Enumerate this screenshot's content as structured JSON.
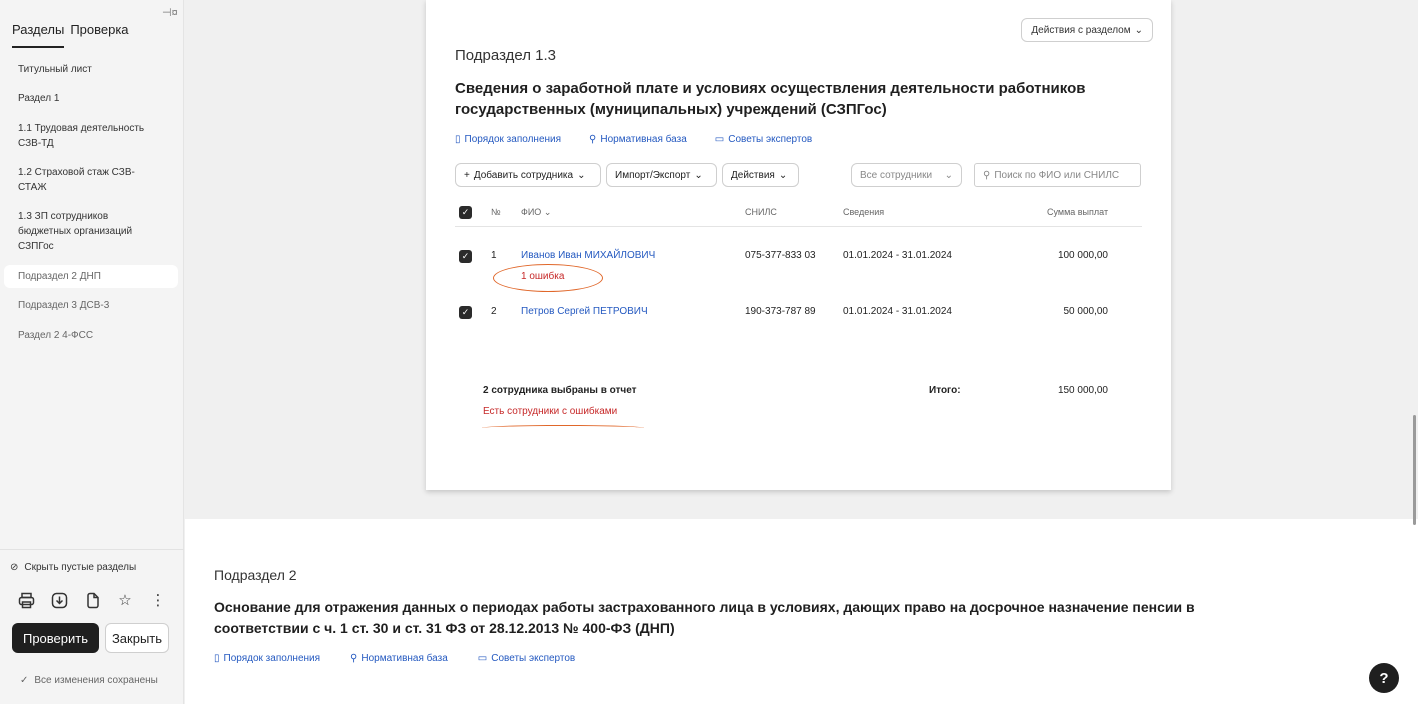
{
  "sidebar": {
    "tabs": [
      {
        "label": "Разделы"
      },
      {
        "label": "Проверка"
      }
    ],
    "items": [
      {
        "label": "Титульный лист"
      },
      {
        "label": "Раздел 1"
      },
      {
        "label": "1.1 Трудовая деятельность\nСЗВ-ТД"
      },
      {
        "label": "1.2 Страховой стаж СЗВ-\nСТАЖ"
      },
      {
        "label": "1.3 ЗП сотрудников\nбюджетных организаций\nСЗПГос"
      },
      {
        "label": "Подраздел 2 ДНП"
      },
      {
        "label": "Подраздел 3 ДСВ-3"
      },
      {
        "label": "Раздел 2 4-ФСС"
      }
    ],
    "hide_empty": "Скрыть пустые разделы",
    "check_button": "Проверить",
    "close_button": "Закрыть",
    "saved_status": "Все изменения сохранены"
  },
  "section13": {
    "actions_button": "Действия с разделом",
    "subtitle": "Подраздел 1.3",
    "title": "Сведения о заработной плате и условиях осуществления деятельности работников государственных (муниципальных) учреждений (СЗПГос)",
    "links": [
      "Порядок заполнения",
      "Нормативная база",
      "Советы экспертов"
    ],
    "toolbar": {
      "add_employee": "Добавить сотрудника",
      "import_export": "Импорт/Экспорт",
      "actions": "Действия",
      "filter": "Все сотрудники",
      "search_placeholder": "Поиск по ФИО или СНИЛС"
    },
    "columns": {
      "num": "№",
      "fio": "ФИО",
      "snils": "СНИЛС",
      "info": "Сведения",
      "sum": "Сумма выплат"
    },
    "rows": [
      {
        "num": "1",
        "fio": "Иванов Иван МИХАЙЛОВИЧ",
        "error": "1 ошибка",
        "snils": "075-377-833 03",
        "period": "01.01.2024 - 31.01.2024",
        "sum": "100 000,00"
      },
      {
        "num": "2",
        "fio": "Петров Сергей ПЕТРОВИЧ",
        "snils": "190-373-787 89",
        "period": "01.01.2024 - 31.01.2024",
        "sum": "50 000,00"
      }
    ],
    "summary": "2 сотрудника выбраны в отчет",
    "summary_error": "Есть сотрудники с ошибками",
    "total_label": "Итого:",
    "total_value": "150 000,00"
  },
  "section2": {
    "subtitle": "Подраздел 2",
    "title": "Основание для отражения данных о периодах работы застрахованного лица в условиях, дающих право на досрочное назначение пенсии в соответствии с ч. 1 ст. 30 и ст. 31 ФЗ от 28.12.2013 № 400-ФЗ (ДНП)",
    "links": [
      "Порядок заполнения",
      "Нормативная база",
      "Советы экспертов"
    ]
  },
  "help_label": "?"
}
